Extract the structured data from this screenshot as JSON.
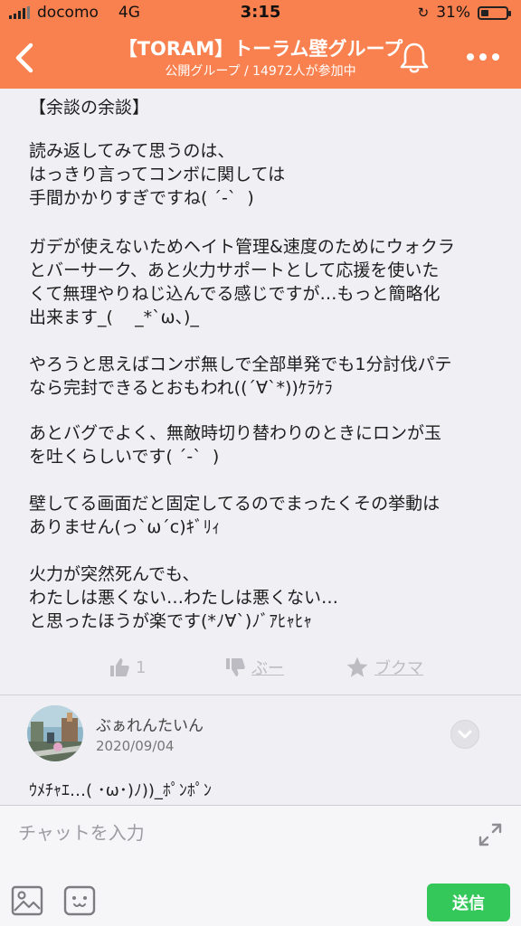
{
  "status_bar": {
    "carrier": "docomo",
    "network": "4G",
    "time": "3:15",
    "battery_percent": "31%",
    "battery_level": 0.31
  },
  "header": {
    "title": "【TORAM】トーラム壁グループ",
    "subtitle": "公開グループ / 14972人が参加中"
  },
  "post": {
    "paragraphs": [
      "【余談の余談】",
      "読み返してみて思うのは、\nはっきり言ってコンボに関しては\n手間かかりすぎですね( ´-`  )",
      "ガデが使えないためヘイト管理&速度のためにウォクラ\nとバーサーク、あと火力サポートとして応援を使いた\nくて無理やりねじ込んでる感じですが…もっと簡略化\n出来ます_(    _*`ω、)_",
      "やろうと思えばコンボ無しで全部単発でも1分討伐パテ\nなら完封できるとおもわれ((´∀`*))ｹﾗｹﾗ",
      "あとバグでよく、無敵時切り替わりのときにロンが玉\nを吐くらしいです( ´-`  )",
      "壁してる画面だと固定してるのでまったくその挙動は\nありません(っ`ω´c)ｷﾞﾘｨ",
      "火力が突然死んでも、\nわたしは悪くない…わたしは悪くない…\nと思ったほうが楽です(*ﾉ∀`)ﾉﾞｱﾋｬﾋｬ"
    ],
    "reactions": {
      "like_count": "1",
      "boo_label": "ぶー",
      "bookmark_label": "ブクマ"
    }
  },
  "comment": {
    "author": "ぶぁれんたいん",
    "date": "2020/09/04",
    "text": "ｳﾒﾁｬｴ…( ･ω･)ﾉ))_ﾎﾟﾝﾎﾟﾝ"
  },
  "chat_bar": {
    "placeholder": "チャットを入力",
    "send_label": "送信"
  },
  "icons": {
    "back": "chevron-left-icon",
    "bell": "bell-icon",
    "more": "more-dots-icon",
    "like": "thumbs-up-icon",
    "boo": "thumbs-down-icon",
    "bookmark": "star-icon",
    "expand": "chevron-down-icon",
    "fullscreen": "expand-arrows-icon",
    "image": "image-icon",
    "emoji": "emoji-icon"
  },
  "colors": {
    "header_bg": "#f9804f",
    "send_bg": "#34c759",
    "reaction_gray": "#bcbcc2"
  }
}
